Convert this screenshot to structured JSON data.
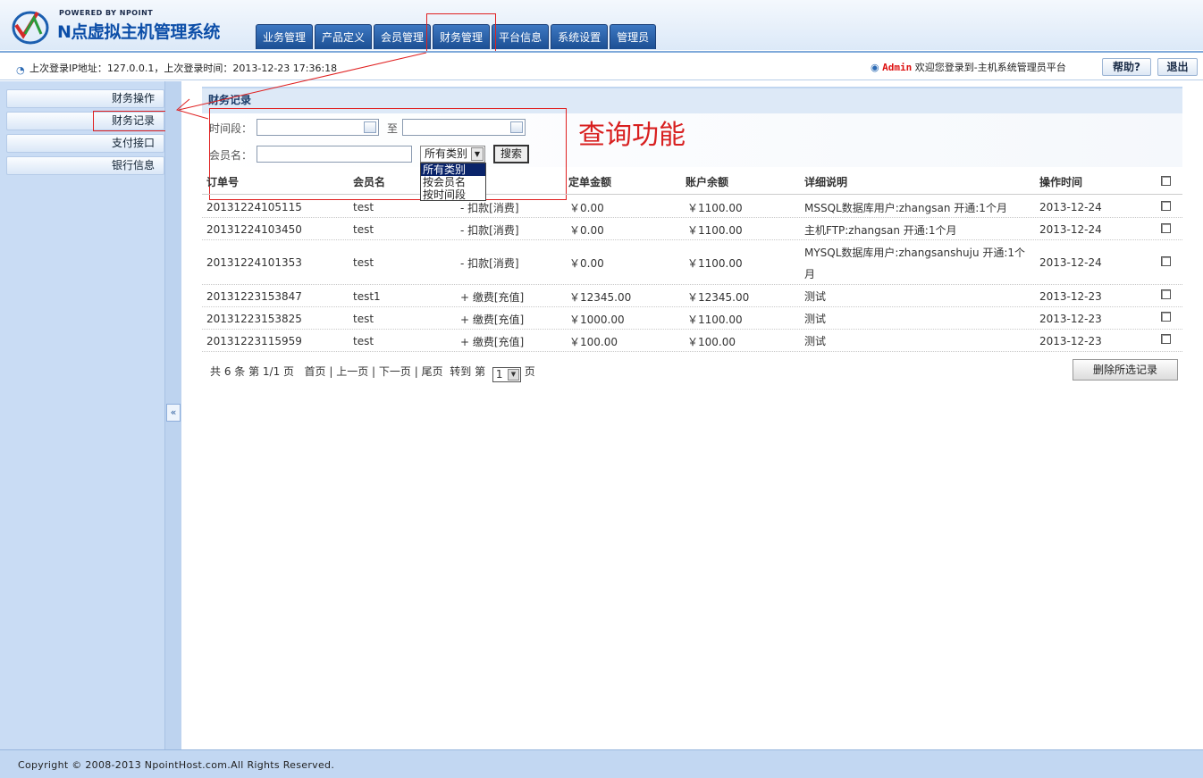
{
  "header": {
    "powered_by": "POWERED BY NPOINT",
    "system_name": "N点虚拟主机管理系统",
    "nav_tabs": [
      "业务管理",
      "产品定义",
      "会员管理",
      "财务管理",
      "平台信息",
      "系统设置",
      "管理员"
    ]
  },
  "infobar": {
    "last_login": "上次登录IP地址：127.0.0.1，上次登录时间：2013-12-23 17:36:18",
    "admin_name": "Admin",
    "welcome": "欢迎您登录到-主机系统管理员平台",
    "help_label": "帮助?",
    "logout_label": "退出"
  },
  "sidebar": {
    "items": [
      "财务操作",
      "财务记录",
      "支付接口",
      "银行信息"
    ],
    "toggle": "«"
  },
  "panel": {
    "title": "财务记录",
    "annotation": "查询功能"
  },
  "search": {
    "period_label": "时间段：",
    "to_label": "至",
    "member_label": "会员名：",
    "category_selected": "所有类别",
    "category_options": [
      "所有类别",
      "按会员名",
      "按时间段"
    ],
    "search_button": "搜索"
  },
  "table": {
    "columns": [
      "订单号",
      "会员名",
      "",
      "定单金额",
      "账户余额",
      "详细说明",
      "操作时间"
    ],
    "rows": [
      {
        "order": "20131224105115",
        "member": "test",
        "type": "- 扣款[消费]",
        "amount": "￥0.00",
        "balance": "￥1100.00",
        "detail": "MSSQL数据库用户:zhangsan 开通:1个月",
        "time": "2013-12-24"
      },
      {
        "order": "20131224103450",
        "member": "test",
        "type": "- 扣款[消费]",
        "amount": "￥0.00",
        "balance": "￥1100.00",
        "detail": "主机FTP:zhangsan 开通:1个月",
        "time": "2013-12-24"
      },
      {
        "order": "20131224101353",
        "member": "test",
        "type": "- 扣款[消费]",
        "amount": "￥0.00",
        "balance": "￥1100.00",
        "detail": "MYSQL数据库用户:zhangsanshuju 开通:1个",
        "detail2": "月",
        "time": "2013-12-24"
      },
      {
        "order": "20131223153847",
        "member": "test1",
        "type": "+ 缴费[充值]",
        "amount": "￥12345.00",
        "balance": "￥12345.00",
        "detail": "测试",
        "time": "2013-12-23"
      },
      {
        "order": "20131223153825",
        "member": "test",
        "type": "+ 缴费[充值]",
        "amount": "￥1000.00",
        "balance": "￥1100.00",
        "detail": "测试",
        "time": "2013-12-23"
      },
      {
        "order": "20131223115959",
        "member": "test",
        "type": "+ 缴费[充值]",
        "amount": "￥100.00",
        "balance": "￥100.00",
        "detail": "测试",
        "time": "2013-12-23"
      }
    ]
  },
  "pager": {
    "total": "共 6 条 第 1/1 页",
    "first": "首页",
    "prev": "上一页",
    "next": "下一页",
    "last": "尾页",
    "goto": "转到 第",
    "page_value": "1",
    "page_suffix": "页",
    "delete_button": "删除所选记录"
  },
  "footer": {
    "copyright": "Copyright © 2008-2013 NpointHost.com.All Rights Reserved."
  },
  "colors": {
    "nav_tab": "#1c4f93",
    "sidebar_bg": "#c9dcf4",
    "highlight": "#e02020",
    "admin": "#dd1111"
  }
}
